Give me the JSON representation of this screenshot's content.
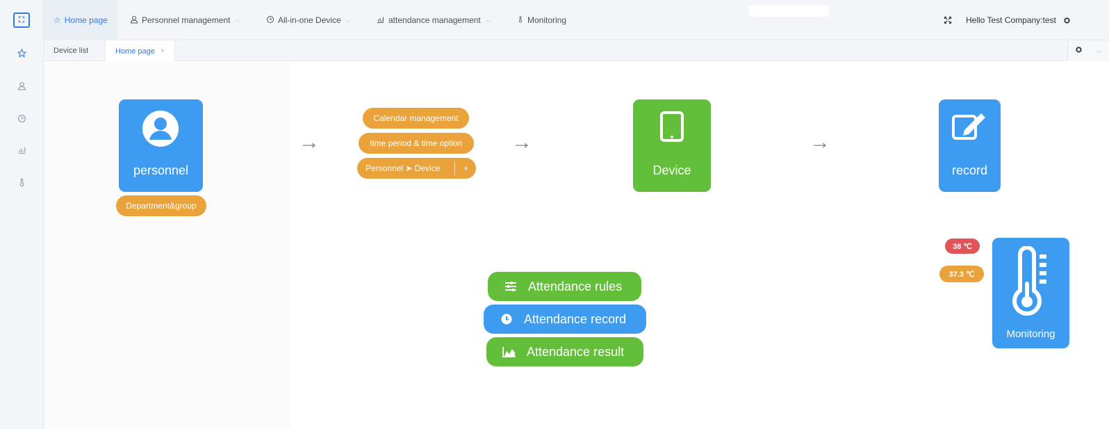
{
  "colors": {
    "accent": "#2f7de1",
    "tile_blue": "#3d9cf0",
    "tile_green": "#63bf3a",
    "tile_orange": "#e9a33a",
    "badge_red": "#e0555a"
  },
  "sidebar": {
    "icons": [
      "logo-icon",
      "star-icon",
      "user-icon",
      "clock-icon",
      "chart-icon",
      "thermometer-icon"
    ]
  },
  "nav": {
    "home": "Home page",
    "personnel": "Personnel management",
    "device": "All-in-one Device",
    "attendance": "attendance management",
    "monitoring": "Monitoring",
    "greeting": "Hello Test Company:test"
  },
  "tabs": {
    "device_list": "Device list",
    "home": "Home page",
    "close": "×"
  },
  "flow": {
    "personnel": {
      "label": "personnel",
      "sub": "Department&group"
    },
    "steps": {
      "calendar": "Calendar management",
      "time_period": "time period & time option",
      "personnel_device": "Personnel ➤ Device",
      "plus": "+"
    },
    "device": {
      "label": "Device"
    },
    "record": {
      "label": "record"
    },
    "arrow": "→"
  },
  "attendance": {
    "rules": "Attendance rules",
    "record": "Attendance record",
    "result": "Attendance result"
  },
  "monitoring": {
    "label": "Monitoring",
    "temp_high": "38 ℃",
    "temp_normal": "37.3 ℃"
  }
}
